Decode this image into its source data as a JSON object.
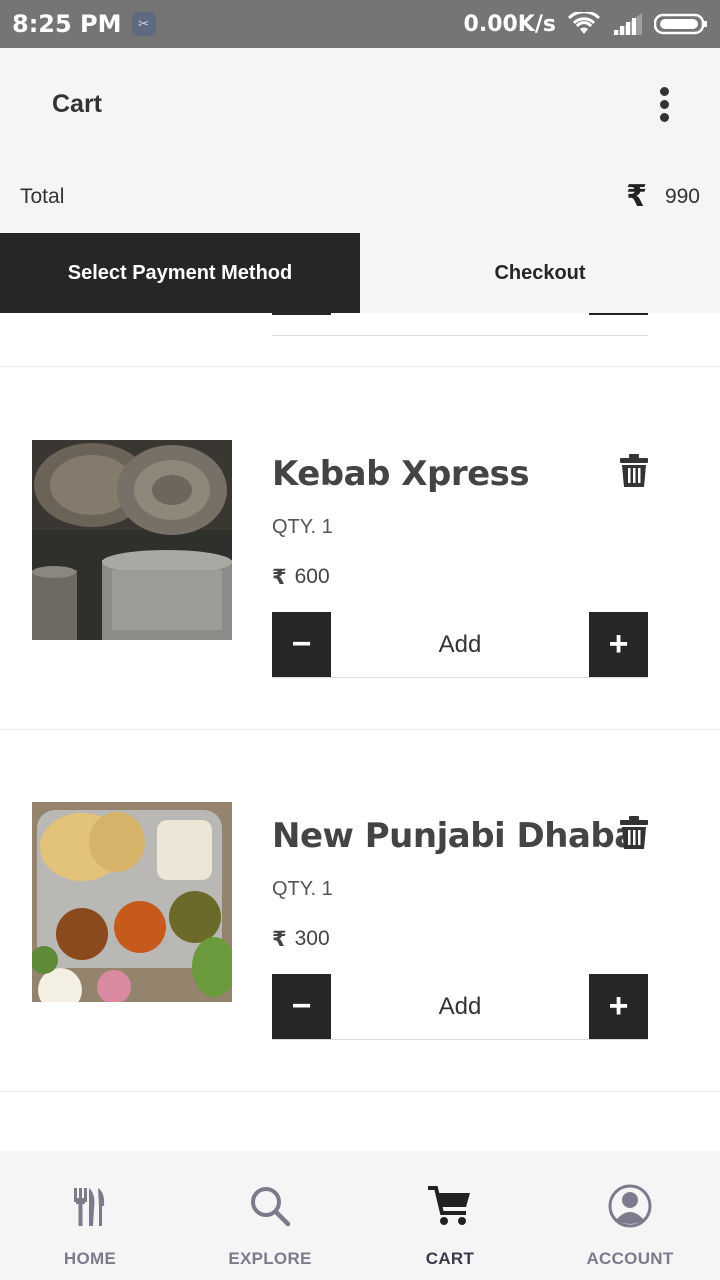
{
  "status_bar": {
    "time": "8:25 PM",
    "speed": "0.00K/s",
    "icons": [
      "notification-icon",
      "wifi-icon",
      "signal-icon",
      "battery-icon"
    ]
  },
  "app_bar": {
    "title": "Cart",
    "menu_icon": "more-vert-icon"
  },
  "summary": {
    "total_label": "Total",
    "currency_symbol": "₹",
    "total_value": "990"
  },
  "actions": {
    "payment_label": "Select Payment Method",
    "checkout_label": "Checkout"
  },
  "cart_items": [
    {
      "name": "Kebab Xpress",
      "qty": "QTY. 1",
      "currency_symbol": "₹",
      "price": "600",
      "add_label": "Add",
      "minus": "−",
      "plus": "+"
    },
    {
      "name": "New Punjabi Dhaba",
      "qty": "QTY. 1",
      "currency_symbol": "₹",
      "price": "300",
      "add_label": "Add",
      "minus": "−",
      "plus": "+"
    }
  ],
  "bottom_nav": {
    "items": [
      {
        "label": "HOME",
        "icon": "fork-knife-icon"
      },
      {
        "label": "EXPLORE",
        "icon": "search-icon"
      },
      {
        "label": "CART",
        "icon": "cart-icon",
        "active": true
      },
      {
        "label": "ACCOUNT",
        "icon": "account-icon"
      }
    ]
  },
  "colors": {
    "dark": "#262626",
    "surface": "#f5f5f5",
    "status_bar": "#757575",
    "nav_label": "#7b7b8c"
  }
}
